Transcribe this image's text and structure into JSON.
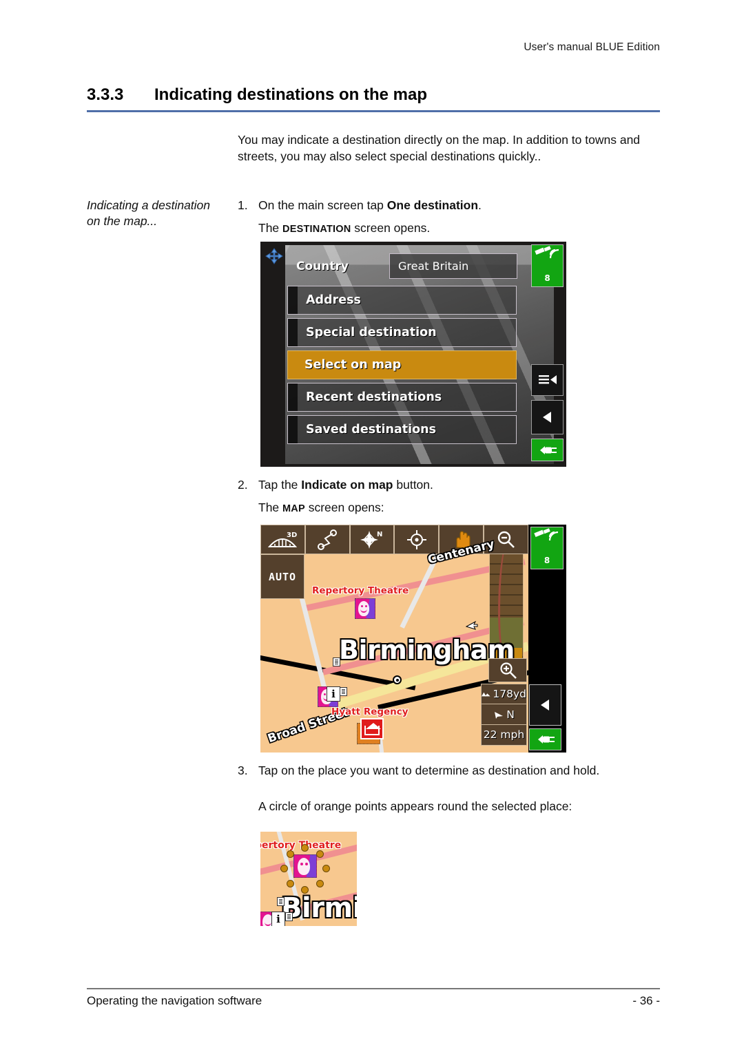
{
  "header": {
    "running_title": "User's manual BLUE Edition"
  },
  "section": {
    "number": "3.3.3",
    "title": "Indicating destinations on the map"
  },
  "intro": "You may indicate a destination directly on the map. In addition to towns and streets, you may also select special destinations quickly..",
  "margin_note": "Indicating a destination on the map...",
  "steps": [
    {
      "num": "1.",
      "text_before": "On the main screen tap ",
      "bold": "One destination",
      "text_after": ".",
      "sub_before": "The ",
      "sub_caps": "DESTINATION",
      "sub_after": " screen opens."
    },
    {
      "num": "2.",
      "text_before": "Tap the ",
      "bold": "Indicate on map",
      "text_after": " button.",
      "sub_before": "The ",
      "sub_caps": "MAP",
      "sub_after": " screen opens:"
    },
    {
      "num": "3.",
      "text_before": "Tap on the place you want to determine as destination and hold.",
      "bold": "",
      "text_after": "",
      "sub_before": "A circle of orange points appears round the selected place:",
      "sub_caps": "",
      "sub_after": ""
    }
  ],
  "footer": {
    "left": "Operating the navigation software",
    "right": "- 36 -"
  },
  "destination_screen": {
    "nav_icon": "navigate-arrow-icon",
    "country_label": "Country",
    "country_value": "Great Britain",
    "menu_items": [
      {
        "label": "Address",
        "selected": false
      },
      {
        "label": "Special destination",
        "selected": false
      },
      {
        "label": "Select on map",
        "selected": true
      },
      {
        "label": "Recent destinations",
        "selected": false
      },
      {
        "label": "Saved destinations",
        "selected": false
      }
    ],
    "gps_icon": "satellite-icon",
    "gps_count": "8",
    "menu_icon": "menu-icon",
    "back_icon": "back-arrow-icon",
    "power_icon": "power-plug-icon",
    "highlight_color": "#c98a10"
  },
  "map_screen": {
    "toolbar": [
      {
        "icon": "perspective-3d-icon",
        "label": "3D"
      },
      {
        "icon": "route-icon",
        "label": ""
      },
      {
        "icon": "compass-north-icon",
        "label": "N"
      },
      {
        "icon": "crosshair-target-icon",
        "label": ""
      },
      {
        "icon": "hand-pan-icon",
        "label": ""
      },
      {
        "icon": "zoom-out-icon",
        "label": ""
      }
    ],
    "auto_button": "AUTO",
    "gps_icon": "satellite-icon",
    "gps_count": "8",
    "zoom_in_icon": "zoom-in-icon",
    "scale_icon": "scale-icon",
    "scale_value": "178yd",
    "compass_icon": "compass-needle-icon",
    "compass_value": "N",
    "speed_value": "22 mph",
    "back_icon": "back-arrow-icon",
    "power_icon": "power-plug-icon",
    "labels": {
      "poi_theatre": "Repertory Theatre",
      "city": "Birmingham",
      "poi_hotel": "Hyatt Regency",
      "street_broad": "Broad Street",
      "street_centenary": "Centenary"
    },
    "map_colors": {
      "land": "#f7c88f",
      "major_road": "#f09090",
      "minor_road": "#f5e69a",
      "block": "#6b4f2c",
      "toolbar": "#54402c"
    }
  },
  "selection_screen": {
    "poi_label": "pertory Theatre",
    "city_label": "Birming",
    "point_color": "#c98a10",
    "point_count": 8
  }
}
